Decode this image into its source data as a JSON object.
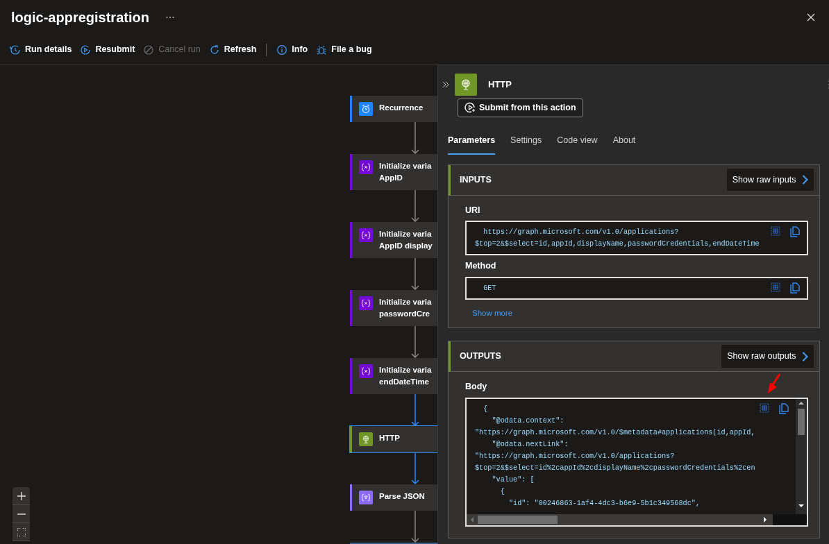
{
  "window": {
    "title": "logic-appregistration"
  },
  "toolbar": {
    "actions": [
      {
        "label": "Run details",
        "disabled": false
      },
      {
        "label": "Resubmit",
        "disabled": false
      },
      {
        "label": "Cancel run",
        "disabled": true
      },
      {
        "label": "Refresh",
        "disabled": false
      }
    ],
    "help": [
      {
        "label": "Info",
        "disabled": false
      },
      {
        "label": "File a bug",
        "disabled": false
      }
    ]
  },
  "canvas": {
    "nodes": [
      {
        "kind": "trigger",
        "lines": [
          "Recurrence"
        ],
        "selected": false,
        "connector_highlighted": false
      },
      {
        "kind": "variable",
        "lines": [
          "Initialize varia",
          "AppID"
        ],
        "selected": false,
        "connector_highlighted": false
      },
      {
        "kind": "variable",
        "lines": [
          "Initialize varia",
          "AppID display"
        ],
        "selected": false,
        "connector_highlighted": false
      },
      {
        "kind": "variable",
        "lines": [
          "Initialize varia",
          "passwordCre"
        ],
        "selected": false,
        "connector_highlighted": false
      },
      {
        "kind": "variable",
        "lines": [
          "Initialize varia",
          "endDateTime"
        ],
        "selected": false,
        "connector_highlighted": true
      },
      {
        "kind": "http",
        "lines": [
          "HTTP"
        ],
        "selected": true,
        "connector_highlighted": true
      },
      {
        "kind": "parse",
        "lines": [
          "Parse JSON"
        ],
        "selected": false,
        "connector_highlighted": false
      },
      {
        "kind": "partial",
        "selected": false
      }
    ]
  },
  "panel": {
    "title": "HTTP",
    "submit_button": "Submit from this action",
    "tabs": [
      {
        "label": "Parameters",
        "selected": true
      },
      {
        "label": "Settings",
        "selected": false
      },
      {
        "label": "Code view",
        "selected": false
      },
      {
        "label": "About",
        "selected": false
      }
    ],
    "sections": [
      {
        "heading": "INPUTS",
        "raw_button": "Show raw inputs",
        "fields": [
          {
            "label": "URI",
            "kind": "value",
            "lines": [
              "  https://graph.microsoft.com/v1.0/applications?",
              "$top=2&$select=id,appId,displayName,passwordCredentials,endDateTime"
            ]
          },
          {
            "label": "Method",
            "kind": "value",
            "lines": [
              "  GET"
            ]
          }
        ],
        "show_more": "Show more"
      },
      {
        "heading": "OUTPUTS",
        "raw_button": "Show raw outputs",
        "fields": [
          {
            "label": "Body",
            "kind": "code",
            "lines": [
              "  {",
              "    \"@odata.context\":",
              "\"https://graph.microsoft.com/v1.0/$metadata#applications(id,appId,",
              "    \"@odata.nextLink\":",
              "\"https://graph.microsoft.com/v1.0/applications?",
              "$top=2&$select=id%2cappId%2cdisplayName%2cpasswordCredentials%2cen",
              "    \"value\": [",
              "      {",
              "        \"id\": \"00246863-1af4-4dc3-b6e9-5b1c349568dc\","
            ]
          }
        ]
      }
    ]
  }
}
